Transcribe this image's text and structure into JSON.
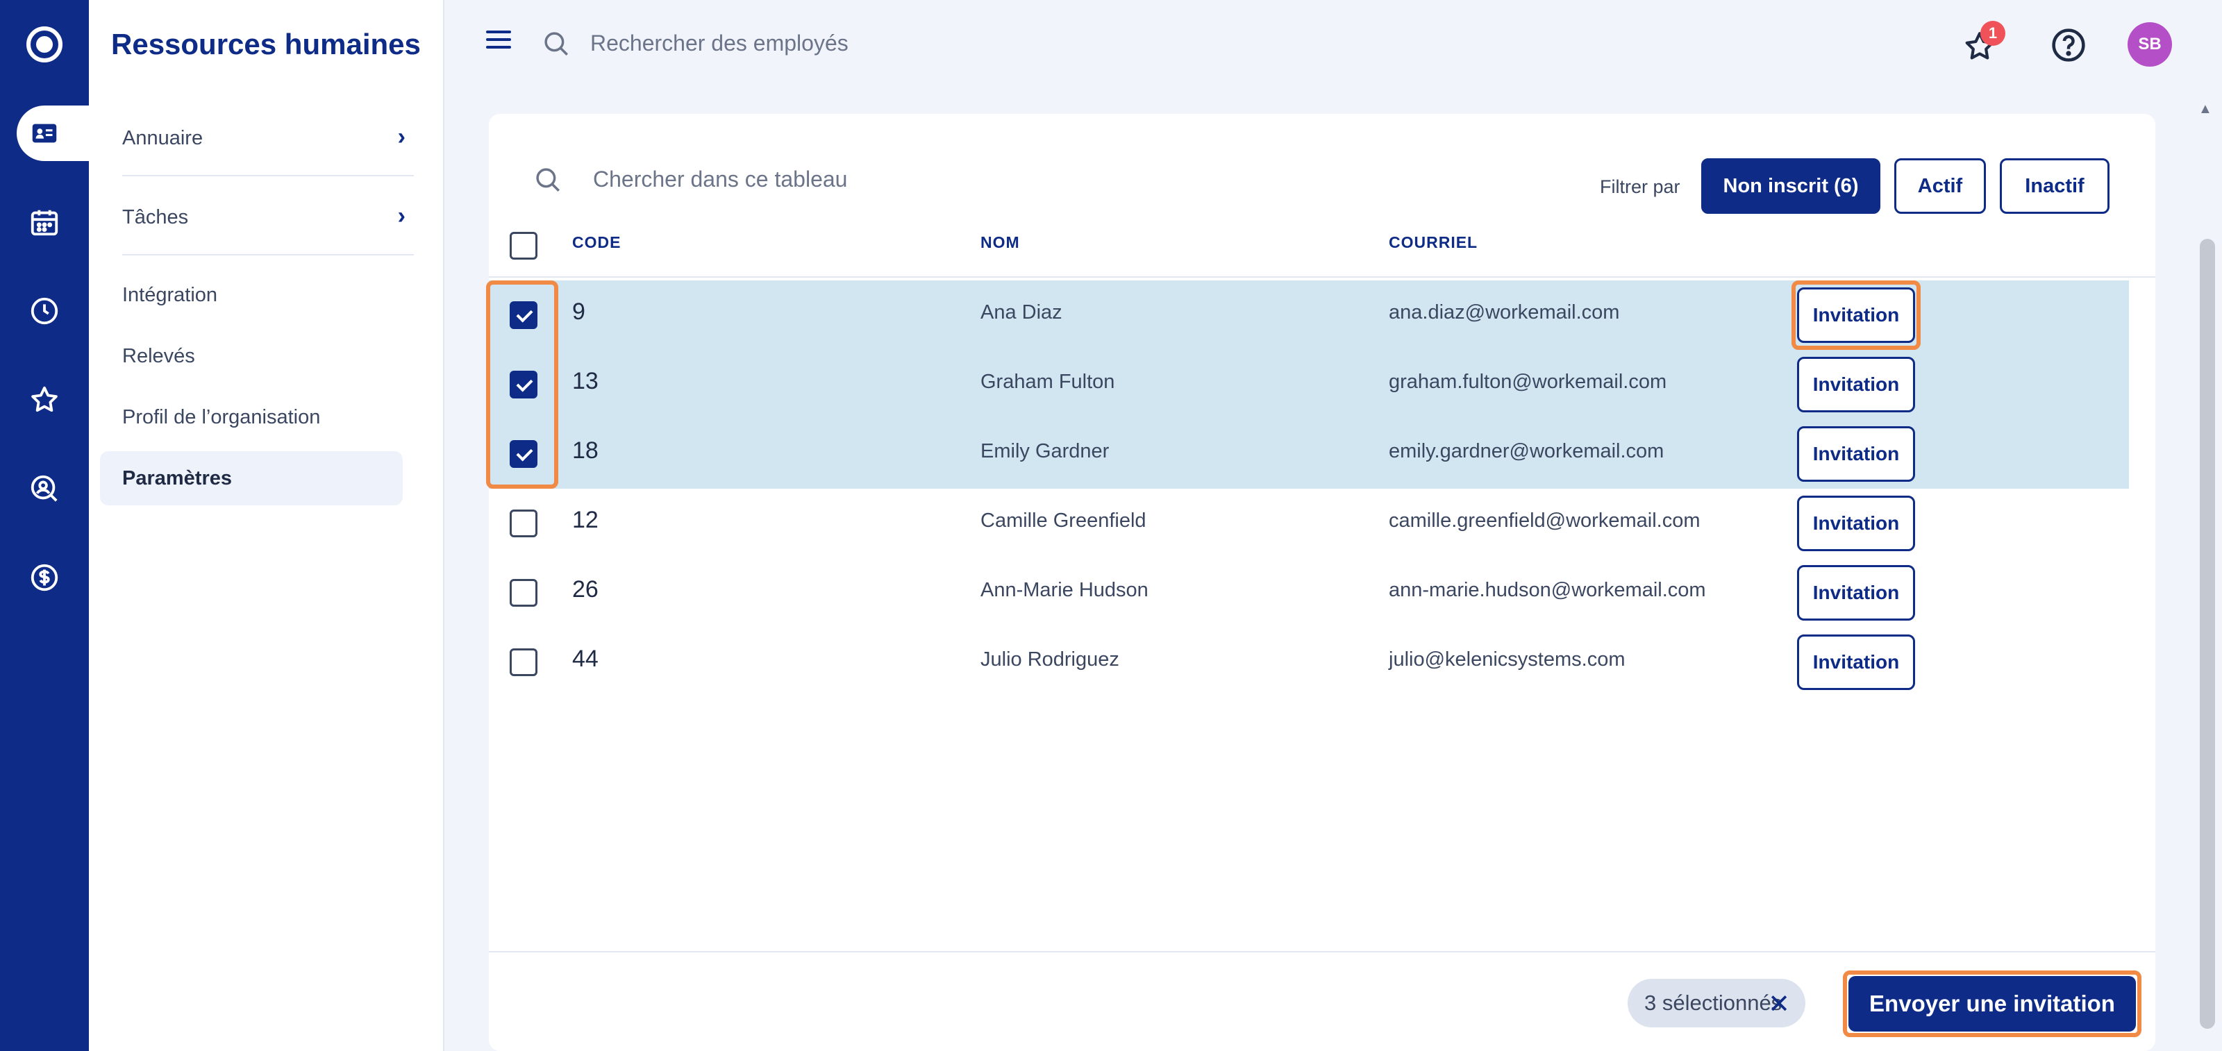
{
  "app": {
    "section_title": "Ressources humaines"
  },
  "rail": {
    "icons": [
      "logo-icon",
      "directory-card-icon",
      "calendar-icon",
      "clock-icon",
      "star-icon",
      "search-person-icon",
      "dollar-icon"
    ],
    "active": "directory-card-icon",
    "color": "#0d2b87"
  },
  "sidebar": {
    "items": [
      {
        "label": "Annuaire",
        "has_chevron": true
      },
      {
        "label": "Tâches",
        "has_chevron": true
      },
      {
        "label": "Intégration"
      },
      {
        "label": "Relevés"
      },
      {
        "label": "Profil de l’organisation"
      },
      {
        "label": "Paramètres",
        "active": true
      }
    ]
  },
  "topbar": {
    "search_placeholder": "Rechercher des employés",
    "notification_count": "1",
    "avatar_initials": "SB",
    "avatar_color": "#b44fc7"
  },
  "table": {
    "search_placeholder": "Chercher dans ce tableau",
    "filter_label": "Filtrer par",
    "filters": [
      {
        "label": "Non inscrit (6)",
        "active": true
      },
      {
        "label": "Actif",
        "active": false
      },
      {
        "label": "Inactif",
        "active": false
      }
    ],
    "columns": [
      "CODE",
      "NOM",
      "COURRIEL"
    ],
    "rows": [
      {
        "code": "9",
        "name": "Ana Diaz",
        "email": "ana.diaz@workemail.com",
        "selected": true,
        "action": "Invitation"
      },
      {
        "code": "13",
        "name": "Graham Fulton",
        "email": "graham.fulton@workemail.com",
        "selected": true,
        "action": "Invitation"
      },
      {
        "code": "18",
        "name": "Emily Gardner",
        "email": "emily.gardner@workemail.com",
        "selected": true,
        "action": "Invitation"
      },
      {
        "code": "12",
        "name": "Camille Greenfield",
        "email": "camille.greenfield@workemail.com",
        "selected": false,
        "action": "Invitation"
      },
      {
        "code": "26",
        "name": "Ann-Marie Hudson",
        "email": "ann-marie.hudson@workemail.com",
        "selected": false,
        "action": "Invitation"
      },
      {
        "code": "44",
        "name": "Julio Rodriguez",
        "email": "julio@kelenicsystems.com",
        "selected": false,
        "action": "Invitation"
      }
    ]
  },
  "footer": {
    "selection_chip": "3 sélectionnés",
    "send_button": "Envoyer une invitation"
  },
  "colors": {
    "primary": "#0d2b87",
    "selected_row": "#d2e6f2",
    "highlight": "#f08a45",
    "badge": "#f0525a"
  }
}
